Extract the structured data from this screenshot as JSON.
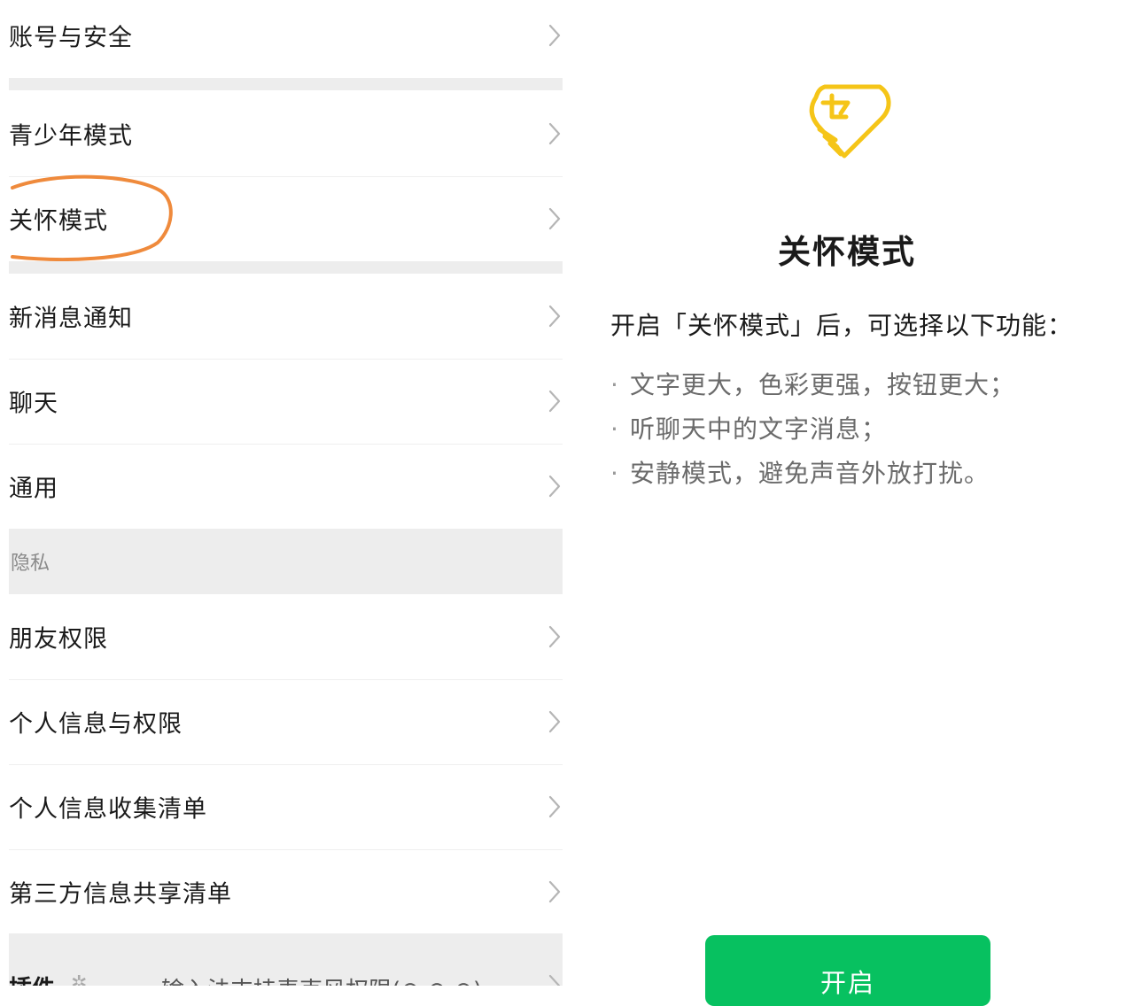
{
  "settings": {
    "items": [
      {
        "label": "账号与安全"
      },
      {
        "label": "青少年模式"
      },
      {
        "label": "关怀模式"
      },
      {
        "label": "新消息通知"
      },
      {
        "label": "聊天"
      },
      {
        "label": "通用"
      },
      {
        "label": "朋友权限"
      },
      {
        "label": "个人信息与权限"
      },
      {
        "label": "个人信息收集清单"
      },
      {
        "label": "第三方信息共享清单"
      }
    ],
    "privacy_header": "隐私",
    "partial_item": {
      "label": "插件",
      "hint": "输入法支持麦克风权限(⊙ ⊙ ⊙)"
    }
  },
  "care_mode": {
    "title": "关怀模式",
    "intro": "开启「关怀模式」后，可选择以下功能：",
    "features": [
      "文字更大，色彩更强，按钮更大；",
      "听聊天中的文字消息；",
      "安静模式，避免声音外放打扰。"
    ],
    "bullet": "·",
    "enable_label": "开启",
    "accent_color": "#07c160",
    "logo_color": "#f5c518",
    "logo_icon": "heart-hand-icon"
  },
  "annotation": {
    "circle_color": "#ef8a3c"
  }
}
